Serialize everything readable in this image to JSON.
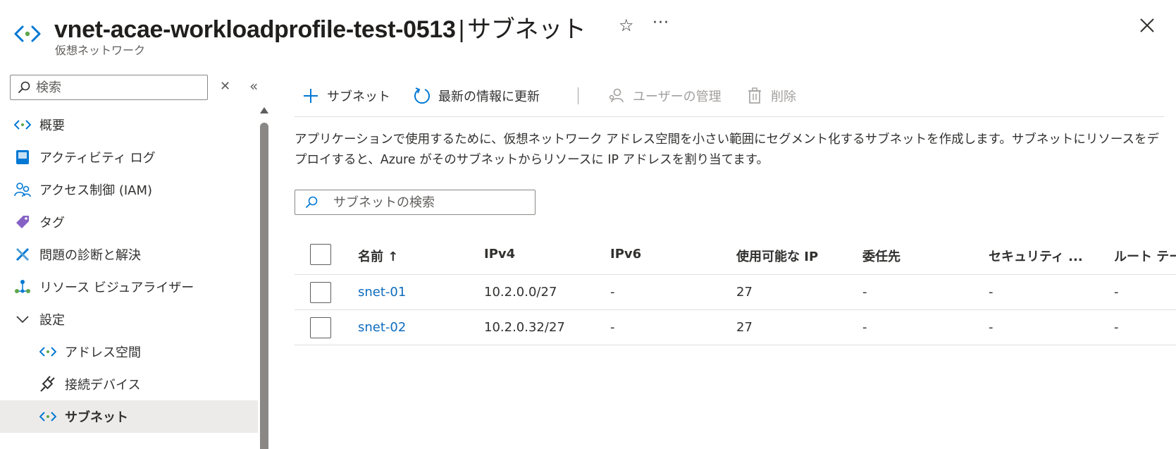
{
  "header": {
    "title": "vnet-acae-workloadprofile-test-0513",
    "separator": "|",
    "section": "サブネット",
    "subtitle": "仮想ネットワーク",
    "star_glyph": "☆",
    "more_glyph": "···",
    "icon": "virtual-network-icon"
  },
  "sidebar": {
    "search_placeholder": "検索",
    "clear_glyph": "✕",
    "collapse_glyph": "«",
    "items": [
      {
        "label": "概要",
        "icon": "vnet-overview-icon"
      },
      {
        "label": "アクティビティ ログ",
        "icon": "activity-log-icon"
      },
      {
        "label": "アクセス制御 (IAM)",
        "icon": "iam-icon"
      },
      {
        "label": "タグ",
        "icon": "tag-icon"
      },
      {
        "label": "問題の診断と解決",
        "icon": "diagnose-icon"
      },
      {
        "label": "リソース ビジュアライザー",
        "icon": "visualizer-icon"
      },
      {
        "label": "設定",
        "icon": "chevron-down-icon"
      },
      {
        "label": "アドレス空間",
        "icon": "address-space-icon"
      },
      {
        "label": "接続デバイス",
        "icon": "connected-devices-icon"
      },
      {
        "label": "サブネット",
        "icon": "subnet-icon",
        "active": true
      }
    ]
  },
  "toolbar": {
    "add_subnet": "サブネット",
    "refresh": "最新の情報に更新",
    "manage_users": "ユーザーの管理",
    "delete": "削除"
  },
  "description": "アプリケーションで使用するために、仮想ネットワーク アドレス空間を小さい範囲にセグメント化するサブネットを作成します。サブネットにリソースをデプロイすると、Azure がそのサブネットからリソースに IP アドレスを割り当てます。",
  "filter": {
    "placeholder": "サブネットの検索"
  },
  "table": {
    "headers": [
      "名前 ↑",
      "IPv4",
      "IPv6",
      "使用可能な IP",
      "委任先",
      "セキュリティ ...",
      "ルート テー"
    ],
    "rows": [
      {
        "name": "snet-01",
        "ipv4": "10.2.0.0/27",
        "ipv6": "-",
        "available_ip": "27",
        "delegated": "-",
        "security": "-",
        "route": "-"
      },
      {
        "name": "snet-02",
        "ipv4": "10.2.0.32/27",
        "ipv6": "-",
        "available_ip": "27",
        "delegated": "-",
        "security": "-",
        "route": "-"
      }
    ]
  },
  "colors": {
    "accent": "#0f6cbd",
    "vnet_blue": "#0078d4",
    "vnet_green": "#5ea64c"
  }
}
